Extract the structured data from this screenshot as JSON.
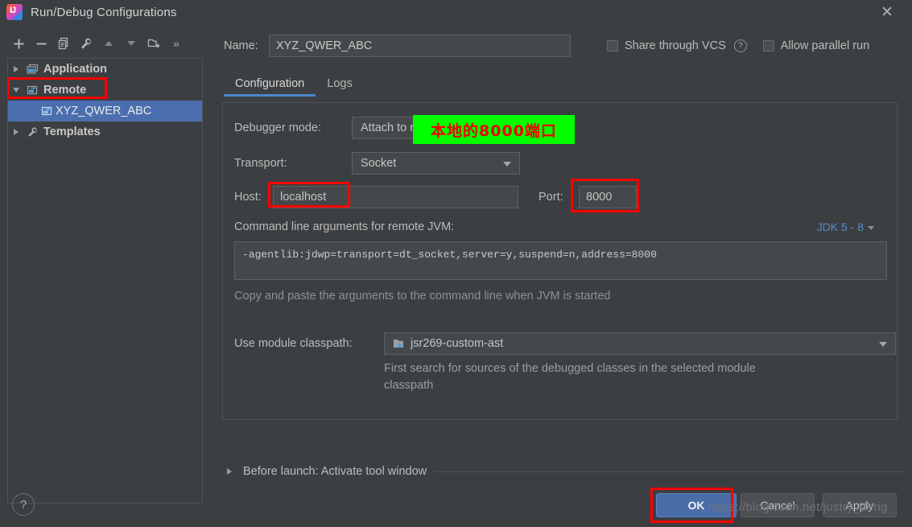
{
  "window": {
    "title": "Run/Debug Configurations",
    "logo_text": "IJ",
    "close_icon": "close-icon"
  },
  "sidebar": {
    "toolbar": [
      {
        "name": "add-configuration-button",
        "icon": "plus-icon"
      },
      {
        "name": "remove-configuration-button",
        "icon": "minus-icon"
      },
      {
        "name": "copy-configuration-button",
        "icon": "copy-icon"
      },
      {
        "name": "edit-templates-button",
        "icon": "wrench-icon"
      },
      {
        "name": "move-up-button",
        "icon": "arrow-up-icon"
      },
      {
        "name": "move-down-button",
        "icon": "arrow-down-icon"
      },
      {
        "name": "move-into-folder-button",
        "icon": "folder-add-icon"
      },
      {
        "name": "more-options-button",
        "icon": "chevron-double-right-icon",
        "label": "»"
      }
    ],
    "tree": [
      {
        "label": "Application",
        "icon": "application-icon",
        "expanded": false,
        "selected": false,
        "child": false
      },
      {
        "label": "Remote",
        "icon": "remote-icon",
        "expanded": true,
        "selected": false,
        "child": false
      },
      {
        "label": "XYZ_QWER_ABC",
        "icon": "remote-icon",
        "expanded": null,
        "selected": true,
        "child": true
      },
      {
        "label": "Templates",
        "icon": "wrench-icon",
        "expanded": false,
        "selected": false,
        "child": false
      }
    ]
  },
  "header": {
    "name_label": "Name:",
    "name_value": "XYZ_QWER_ABC",
    "share_vcs_label": "Share through VCS",
    "share_vcs_checked": false,
    "share_help_icon": "question-mark-icon",
    "allow_parallel_label": "Allow parallel run",
    "allow_parallel_checked": false
  },
  "tabs": [
    {
      "label": "Configuration",
      "active": true
    },
    {
      "label": "Logs",
      "active": false
    }
  ],
  "config": {
    "debugger_mode_label": "Debugger mode:",
    "debugger_mode_value": "Attach to remote JVM",
    "transport_label": "Transport:",
    "transport_value": "Socket",
    "host_label": "Host:",
    "host_value": "localhost",
    "port_label": "Port:",
    "port_value": "8000",
    "args_label": "Command line arguments for remote JVM:",
    "jdk_selector": "JDK 5 - 8",
    "args_value": "-agentlib:jdwp=transport=dt_socket,server=y,suspend=n,address=8000",
    "args_hint": "Copy and paste the arguments to the command line when JVM is started",
    "classpath_label": "Use module classpath:",
    "classpath_value": "jsr269-custom-ast",
    "classpath_icon": "module-folder-icon",
    "classpath_desc": "First search for sources of the debugged classes in the selected module classpath"
  },
  "before_launch": {
    "label": "Before launch: Activate tool window",
    "expand_icon": "triangle-right-icon"
  },
  "footer": {
    "help_label": "?",
    "ok_label": "OK",
    "cancel_label": "Cancel",
    "apply_label": "Apply"
  },
  "annotations": {
    "green_note_text": "本地的8000端口",
    "green_bg": "#00ff00",
    "note_color": "#ee0000",
    "highlight_color": "#ff0000",
    "watermark": "https://blog.csdn.net/justry_deng"
  }
}
